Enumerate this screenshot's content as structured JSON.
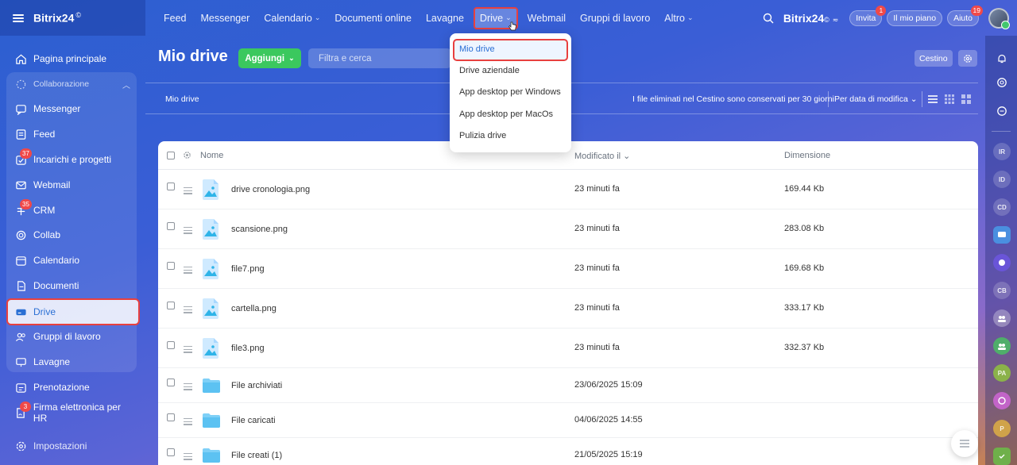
{
  "topbar": {
    "brand": "Bitrix24",
    "brand_mark": "©",
    "nav": [
      "Feed",
      "Messenger",
      "Calendario",
      "Documenti online",
      "Lavagne",
      "Drive",
      "Webmail",
      "Gruppi di lavoro",
      "Altro"
    ],
    "brand_right": "Bitrix24",
    "invite_label": "Invita",
    "invite_count": "1",
    "plan_label": "Il mio piano",
    "help_label": "Aiuto",
    "help_count": "19"
  },
  "sidebar": {
    "items": [
      {
        "label": "Pagina principale",
        "icon": "home-icon"
      },
      {
        "label": "Collaborazione",
        "icon": "collab-group-icon"
      },
      {
        "label": "Messenger",
        "icon": "chat-icon"
      },
      {
        "label": "Feed",
        "icon": "feed-icon"
      },
      {
        "label": "Incarichi e progetti",
        "icon": "tasks-icon",
        "badge": "37"
      },
      {
        "label": "Webmail",
        "icon": "mail-icon"
      },
      {
        "label": "CRM",
        "icon": "crm-icon",
        "badge": "35"
      },
      {
        "label": "Collab",
        "icon": "collab-icon"
      },
      {
        "label": "Calendario",
        "icon": "calendar-icon"
      },
      {
        "label": "Documenti",
        "icon": "document-icon"
      },
      {
        "label": "Drive",
        "icon": "drive-icon"
      },
      {
        "label": "Gruppi di lavoro",
        "icon": "group-icon"
      },
      {
        "label": "Lavagne",
        "icon": "board-icon"
      },
      {
        "label": "Prenotazione",
        "icon": "booking-icon"
      },
      {
        "label": "Firma elettronica per HR",
        "icon": "signature-icon",
        "badge": "3"
      },
      {
        "label": "Impostazioni",
        "icon": "settings-icon"
      }
    ]
  },
  "main": {
    "title": "Mio drive",
    "add_label": "Aggiungi",
    "filter_placeholder": "Filtra e cerca",
    "trash_label": "Cestino",
    "breadcrumb": "Mio drive",
    "trash_note": "I file eliminati nel Cestino sono conservati per 30 giorni",
    "sort_label": "Per data di modifica"
  },
  "dropdown": {
    "items": [
      "Mio drive",
      "Drive aziendale",
      "App desktop per Windows",
      "App desktop per MacOs",
      "Pulizia drive"
    ]
  },
  "table": {
    "headers": {
      "name": "Nome",
      "modified": "Modificato il",
      "size": "Dimensione"
    },
    "rows": [
      {
        "name": "drive cronologia.png",
        "modified": "23 minuti fa",
        "size": "169.44 Kb",
        "type": "image"
      },
      {
        "name": "scansione.png",
        "modified": "23 minuti fa",
        "size": "283.08 Kb",
        "type": "image"
      },
      {
        "name": "file7.png",
        "modified": "23 minuti fa",
        "size": "169.68 Kb",
        "type": "image"
      },
      {
        "name": "cartella.png",
        "modified": "23 minuti fa",
        "size": "333.17 Kb",
        "type": "image"
      },
      {
        "name": "file3.png",
        "modified": "23 minuti fa",
        "size": "332.37 Kb",
        "type": "image"
      },
      {
        "name": "File archiviati",
        "modified": "23/06/2025 15:09",
        "size": "",
        "type": "folder"
      },
      {
        "name": "File caricati",
        "modified": "04/06/2025 14:55",
        "size": "",
        "type": "folder"
      },
      {
        "name": "File creati (1)",
        "modified": "21/05/2025 15:19",
        "size": "",
        "type": "folder"
      }
    ]
  },
  "rail": {
    "initials": [
      "IR",
      "ID",
      "CD",
      "CB",
      "PA",
      "P"
    ]
  },
  "colors": {
    "accent": "#2a6fd4",
    "add_button": "#3bc85e",
    "badge": "#f04949",
    "highlight": "#e8403f"
  }
}
